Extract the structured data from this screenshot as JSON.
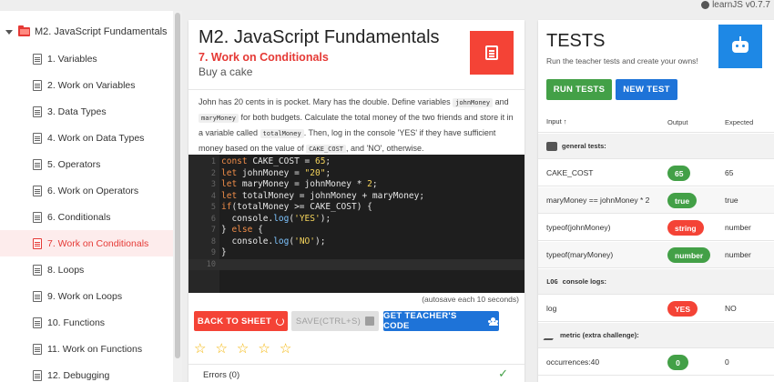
{
  "app": {
    "version": "learnJS v0.7.7",
    "brand_color": "#e53935"
  },
  "sidebar": {
    "module": "M2. JavaScript Fundamentals",
    "items": [
      {
        "label": "1. Variables"
      },
      {
        "label": "2. Work on Variables"
      },
      {
        "label": "3. Data Types"
      },
      {
        "label": "4. Work on Data Types"
      },
      {
        "label": "5. Operators"
      },
      {
        "label": "6. Work on Operators"
      },
      {
        "label": "6. Conditionals"
      },
      {
        "label": "7. Work on Conditionals",
        "active": true
      },
      {
        "label": "8. Loops"
      },
      {
        "label": "9. Work on Loops"
      },
      {
        "label": "10. Functions"
      },
      {
        "label": "11. Work on Functions"
      },
      {
        "label": "12. Debugging"
      }
    ]
  },
  "lesson": {
    "title": "M2. JavaScript Fundamentals",
    "subtitle": "7. Work on Conditionals",
    "task": "Buy a cake",
    "desc": {
      "p1": "John has 20 cents in is pocket. Mary has the double. Define variables ",
      "c1": "johnMoney",
      "p2": " and ",
      "c2": "maryMoney",
      "p3": " for both budgets. Calculate the total money of the two friends and store it in a variable called ",
      "c3": "totalMoney",
      "p4": ". Then, log in the console 'YES' if they have sufficient money based on the value of ",
      "c4": "CAKE_COST",
      "p5": ", and 'NO', otherwise."
    },
    "code_lines": [
      "const CAKE_COST = 65;",
      "let johnMoney = \"20\";",
      "let maryMoney = johnMoney * 2;",
      "let totalMoney = johnMoney + maryMoney;",
      "if(totalMoney >= CAKE_COST) {",
      "  console.log('YES');",
      "} else {",
      "  console.log('NO');",
      "}",
      ""
    ],
    "autosave": "(autosave each 10 seconds)",
    "buttons": {
      "back": "BACK TO SHEET",
      "save": "SAVE(CTRL+S)",
      "teacher": "GET TEACHER'S CODE"
    },
    "rating": {
      "value": 0,
      "max": 5
    },
    "errors": "Errors (0)"
  },
  "tests": {
    "title": "TESTS",
    "subtitle": "Run the teacher tests and create your owns!",
    "run_label": "RUN TESTS",
    "new_label": "NEW TEST",
    "columns": {
      "input": "Input",
      "output": "Output",
      "expected": "Expected"
    },
    "sections": {
      "general": "general tests:",
      "console_icon": "LOG",
      "console": "console logs:",
      "metric": "metric (extra challenge):"
    },
    "rows": [
      {
        "input": "CAKE_COST",
        "output": "65",
        "expected": "65",
        "status": "ok"
      },
      {
        "input": "maryMoney == johnMoney * 2",
        "output": "true",
        "expected": "true",
        "status": "ok"
      },
      {
        "input": "typeof(johnMoney)",
        "output": "string",
        "expected": "number",
        "status": "bad"
      },
      {
        "input": "typeof(maryMoney)",
        "output": "number",
        "expected": "number",
        "status": "ok"
      },
      {
        "input": "log",
        "output": "YES",
        "expected": "NO",
        "status": "bad"
      },
      {
        "input": "occurrences:40",
        "output": "0",
        "expected": "0",
        "status": "ok"
      }
    ]
  }
}
